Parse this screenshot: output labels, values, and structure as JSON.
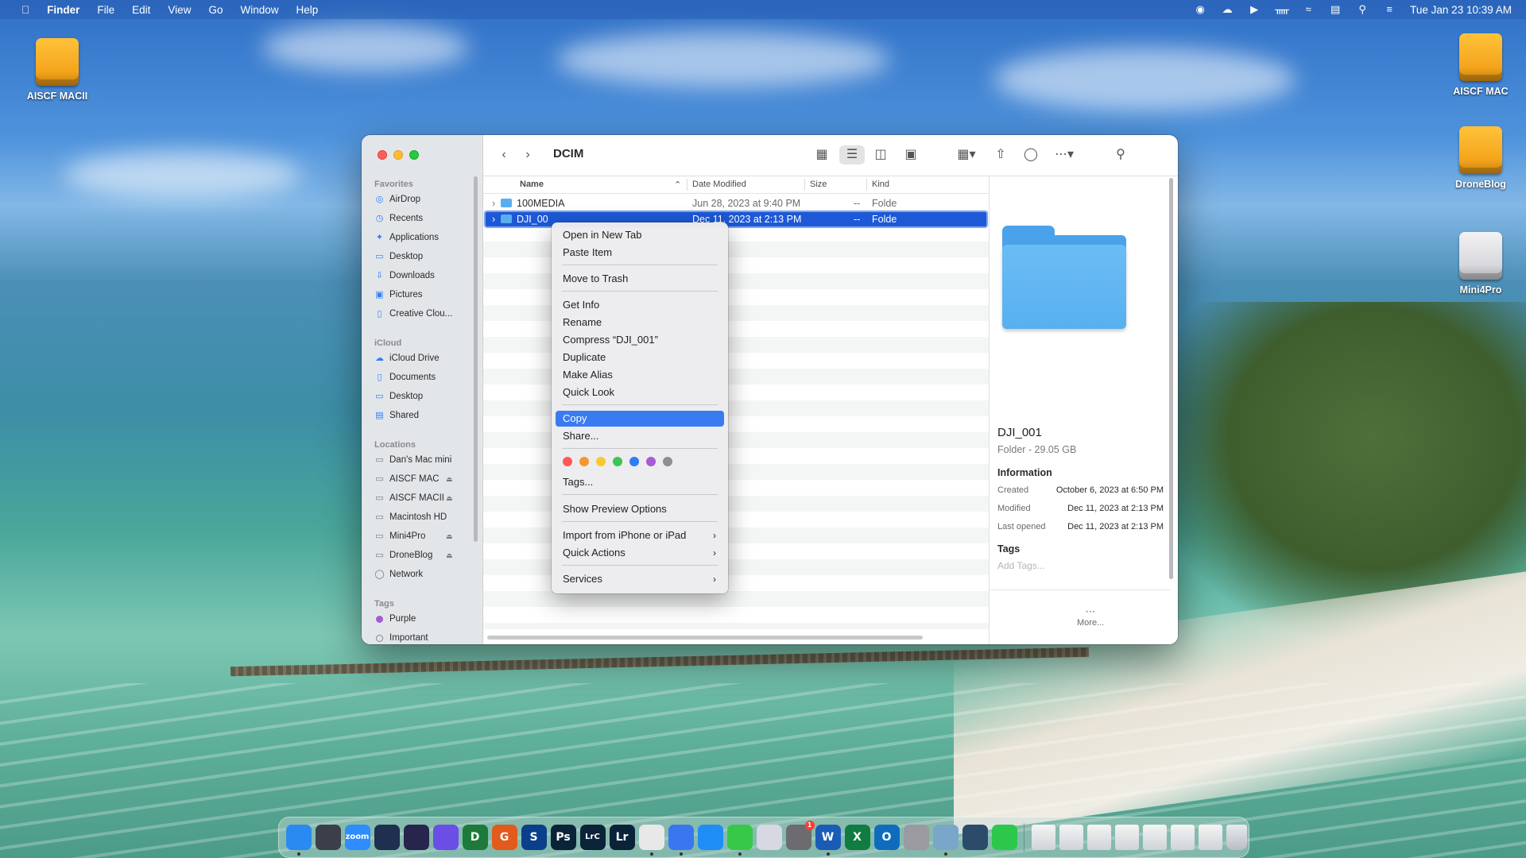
{
  "menubar": {
    "app": "Finder",
    "menus": [
      "File",
      "Edit",
      "View",
      "Go",
      "Window",
      "Help"
    ],
    "clock": "Tue Jan 23  10:39 AM"
  },
  "desktop": {
    "icons": [
      {
        "label": "AISCF MACII"
      },
      {
        "label": "AISCF MAC"
      },
      {
        "label": "DroneBlog"
      },
      {
        "label": "Mini4Pro"
      }
    ]
  },
  "window": {
    "title": "DCIM",
    "sidebar": {
      "favorites_header": "Favorites",
      "favorites": [
        "AirDrop",
        "Recents",
        "Applications",
        "Desktop",
        "Downloads",
        "Pictures",
        "Creative Clou..."
      ],
      "icloud_header": "iCloud",
      "icloud": [
        "iCloud Drive",
        "Documents",
        "Desktop",
        "Shared"
      ],
      "locations_header": "Locations",
      "locations": [
        "Dan's Mac mini",
        "AISCF MAC",
        "AISCF MACII",
        "Macintosh HD",
        "Mini4Pro",
        "DroneBlog",
        "Network"
      ],
      "tags_header": "Tags",
      "tags": [
        "Purple",
        "Important"
      ]
    },
    "columns": {
      "name": "Name",
      "date": "Date Modified",
      "size": "Size",
      "kind": "Kind"
    },
    "rows": [
      {
        "name": "100MEDIA",
        "date": "Jun 28, 2023 at 9:40 PM",
        "size": "--",
        "kind": "Folde"
      },
      {
        "name": "DJI_00",
        "date": "Dec 11, 2023 at 2:13 PM",
        "size": "--",
        "kind": "Folde"
      }
    ],
    "preview": {
      "name": "DJI_001",
      "subtitle": "Folder - 29.05 GB",
      "info_header": "Information",
      "created_label": "Created",
      "created_value": "October 6, 2023 at 6:50 PM",
      "modified_label": "Modified",
      "modified_value": "Dec 11, 2023 at 2:13 PM",
      "opened_label": "Last opened",
      "opened_value": "Dec 11, 2023 at 2:13 PM",
      "tags_header": "Tags",
      "tags_placeholder": "Add Tags...",
      "more_label": "More..."
    }
  },
  "context_menu": {
    "items": {
      "open_new_tab": "Open in New Tab",
      "paste_item": "Paste Item",
      "move_to_trash": "Move to Trash",
      "get_info": "Get Info",
      "rename": "Rename",
      "compress": "Compress “DJI_001”",
      "duplicate": "Duplicate",
      "make_alias": "Make Alias",
      "quick_look": "Quick Look",
      "copy": "Copy",
      "share": "Share...",
      "tags": "Tags...",
      "show_preview_options": "Show Preview Options",
      "import_iphone": "Import from iPhone or iPad",
      "quick_actions": "Quick Actions",
      "services": "Services"
    },
    "tag_colors": [
      "#ff5a52",
      "#f5962d",
      "#f7c830",
      "#3dc454",
      "#2f7df6",
      "#a65ad6",
      "#8e8e93"
    ]
  },
  "dock": {
    "apps": [
      {
        "name": "finder-icon",
        "label": "",
        "color": "#2a8af2"
      },
      {
        "name": "davinci-icon",
        "label": "",
        "color": "#3b3f4a"
      },
      {
        "name": "zoom-icon",
        "label": "zoom",
        "color": "#2d8cff"
      },
      {
        "name": "affinity-icon",
        "label": "",
        "color": "#1f2f4f"
      },
      {
        "name": "affinity-photo-icon",
        "label": "",
        "color": "#27244d"
      },
      {
        "name": "proton-vpn-icon",
        "label": "",
        "color": "#6b4ee6"
      },
      {
        "name": "d-app-icon",
        "label": "D",
        "color": "#1e7a3a"
      },
      {
        "name": "g-app-icon",
        "label": "G",
        "color": "#e25a1c"
      },
      {
        "name": "s-app-icon",
        "label": "S",
        "color": "#0b3f8a"
      },
      {
        "name": "photoshop-icon",
        "label": "Ps",
        "color": "#0b2338"
      },
      {
        "name": "lightroom-classic-icon",
        "label": "LrC",
        "color": "#0b2338"
      },
      {
        "name": "lightroom-icon",
        "label": "Lr",
        "color": "#0b2338"
      },
      {
        "name": "chrome-icon",
        "label": "",
        "color": "#e8e8e8"
      },
      {
        "name": "signal-icon",
        "label": "",
        "color": "#3a76f0"
      },
      {
        "name": "app-store-icon",
        "label": "",
        "color": "#1e8df5"
      },
      {
        "name": "messages-icon",
        "label": "",
        "color": "#37c84a"
      },
      {
        "name": "launchpad-icon",
        "label": "",
        "color": "#d8d8e2"
      },
      {
        "name": "system-settings-icon",
        "label": "",
        "color": "#6c6c70"
      },
      {
        "name": "word-icon",
        "label": "W",
        "color": "#1b5bb8"
      },
      {
        "name": "excel-icon",
        "label": "X",
        "color": "#107c41"
      },
      {
        "name": "outlook-icon",
        "label": "O",
        "color": "#0f6cbd"
      },
      {
        "name": "dvd-player-icon",
        "label": "",
        "color": "#9a9aa0"
      },
      {
        "name": "preview-icon",
        "label": "",
        "color": "#7aa6c9"
      },
      {
        "name": "quicktime-icon",
        "label": "",
        "color": "#2c4a6a"
      },
      {
        "name": "facetime-icon",
        "label": "",
        "color": "#2bc84b"
      }
    ],
    "docs": [
      {
        "name": "stack-1-icon"
      },
      {
        "name": "stack-2-icon"
      },
      {
        "name": "stack-3-icon"
      },
      {
        "name": "stack-4-icon"
      },
      {
        "name": "stack-5-icon"
      },
      {
        "name": "stack-6-icon"
      },
      {
        "name": "stack-7-icon"
      }
    ],
    "badge": "1"
  }
}
